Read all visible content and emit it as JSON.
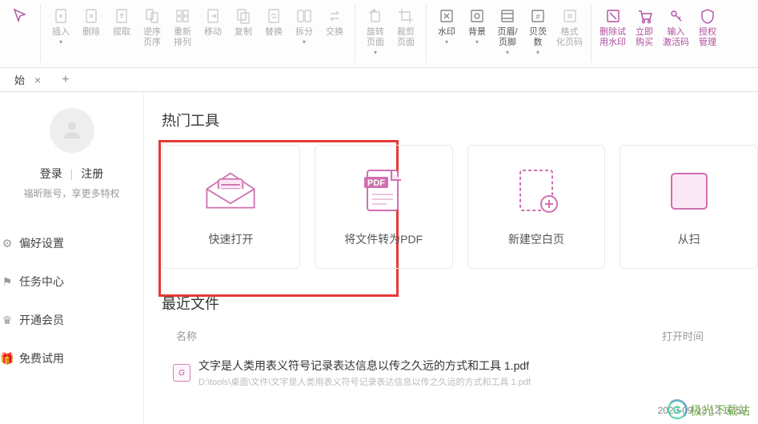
{
  "toolbar": {
    "groups": [
      {
        "items": [
          {
            "name": "select-tool",
            "label": "",
            "icon": "cursor",
            "accent": true
          }
        ]
      },
      {
        "items": [
          {
            "name": "insert-btn",
            "label": "插入",
            "icon": "page-plus",
            "dim": true,
            "drop": true
          },
          {
            "name": "delete-btn",
            "label": "删除",
            "icon": "page-x",
            "dim": true
          },
          {
            "name": "extract-btn",
            "label": "提取",
            "icon": "page-out",
            "dim": true
          },
          {
            "name": "reverse-order-btn",
            "label": "逆序\n页序",
            "icon": "page-swap",
            "dim": true
          },
          {
            "name": "reorder-btn",
            "label": "重新\n排列",
            "icon": "page-grid",
            "dim": true
          },
          {
            "name": "move-btn",
            "label": "移动",
            "icon": "page-move",
            "dim": true
          },
          {
            "name": "duplicate-btn",
            "label": "复制",
            "icon": "page-copy",
            "dim": true
          },
          {
            "name": "replace-btn",
            "label": "替换",
            "icon": "page-replace",
            "dim": true
          },
          {
            "name": "split-btn",
            "label": "拆分",
            "icon": "page-split",
            "dim": true,
            "drop": true
          },
          {
            "name": "swap-btn",
            "label": "交换",
            "icon": "page-exchange",
            "dim": true
          }
        ]
      },
      {
        "items": [
          {
            "name": "rotate-page-btn",
            "label": "旋转\n页面",
            "icon": "rotate",
            "dim": true,
            "drop": true
          },
          {
            "name": "crop-page-btn",
            "label": "裁剪\n页面",
            "icon": "crop",
            "dim": true
          }
        ]
      },
      {
        "items": [
          {
            "name": "watermark-btn",
            "label": "水印",
            "icon": "watermark",
            "dim": false,
            "drop": true
          },
          {
            "name": "background-btn",
            "label": "背景",
            "icon": "background",
            "dim": false,
            "drop": true
          },
          {
            "name": "header-footer-btn",
            "label": "页眉/\n页脚",
            "icon": "headerfooter",
            "dim": false,
            "drop": true
          },
          {
            "name": "bates-btn",
            "label": "贝茨\n数",
            "icon": "bates",
            "dim": false,
            "drop": true
          },
          {
            "name": "format-pagenum-btn",
            "label": "格式\n化页码",
            "icon": "pagenum",
            "dim": true
          }
        ]
      },
      {
        "items": [
          {
            "name": "remove-trial-watermark-btn",
            "label": "删除试\n用水印",
            "icon": "rm-wm",
            "accent": true
          },
          {
            "name": "buy-now-btn",
            "label": "立即\n购买",
            "icon": "cart",
            "accent": true
          },
          {
            "name": "enter-code-btn",
            "label": "输入\n激活码",
            "icon": "key",
            "accent": true
          },
          {
            "name": "license-mgmt-btn",
            "label": "授权\n管理",
            "icon": "shield",
            "accent": true
          }
        ]
      }
    ]
  },
  "tabs": {
    "active": "始",
    "add": "+"
  },
  "sidebar": {
    "login": "登录",
    "sep": "|",
    "register": "注册",
    "subtext": "福昕账号，享更多特权",
    "items": [
      {
        "name": "sidebar-preferences",
        "label": "偏好设置",
        "icon": "gear"
      },
      {
        "name": "sidebar-tasks",
        "label": "任务中心",
        "icon": "flag"
      },
      {
        "name": "sidebar-vip",
        "label": "开通会员",
        "icon": "crown"
      },
      {
        "name": "sidebar-trial",
        "label": "免费试用",
        "icon": "gift"
      }
    ]
  },
  "content": {
    "hot_tools_title": "热门工具",
    "cards": [
      {
        "name": "card-quick-open",
        "label": "快速打开",
        "icon": "envelope"
      },
      {
        "name": "card-to-pdf",
        "label": "将文件转为PDF",
        "icon": "pdf"
      },
      {
        "name": "card-blank",
        "label": "新建空白页",
        "icon": "blank"
      },
      {
        "name": "card-scan",
        "label": "从扫",
        "icon": "scan"
      }
    ],
    "recent_title": "最近文件",
    "columns": {
      "name": "名称",
      "time": "打开时间"
    },
    "files": [
      {
        "name": "文字是人类用表义符号记录表达信息以传之久远的方式和工具 1.pdf",
        "path": "D:\\tools\\桌面\\文件\\文字是人类用表义符号记录表达信息以传之久远的方式和工具 1.pdf"
      }
    ]
  },
  "watermark": {
    "brand": "极光下载站",
    "timestamp": "2023-09-12 12:16:59"
  }
}
